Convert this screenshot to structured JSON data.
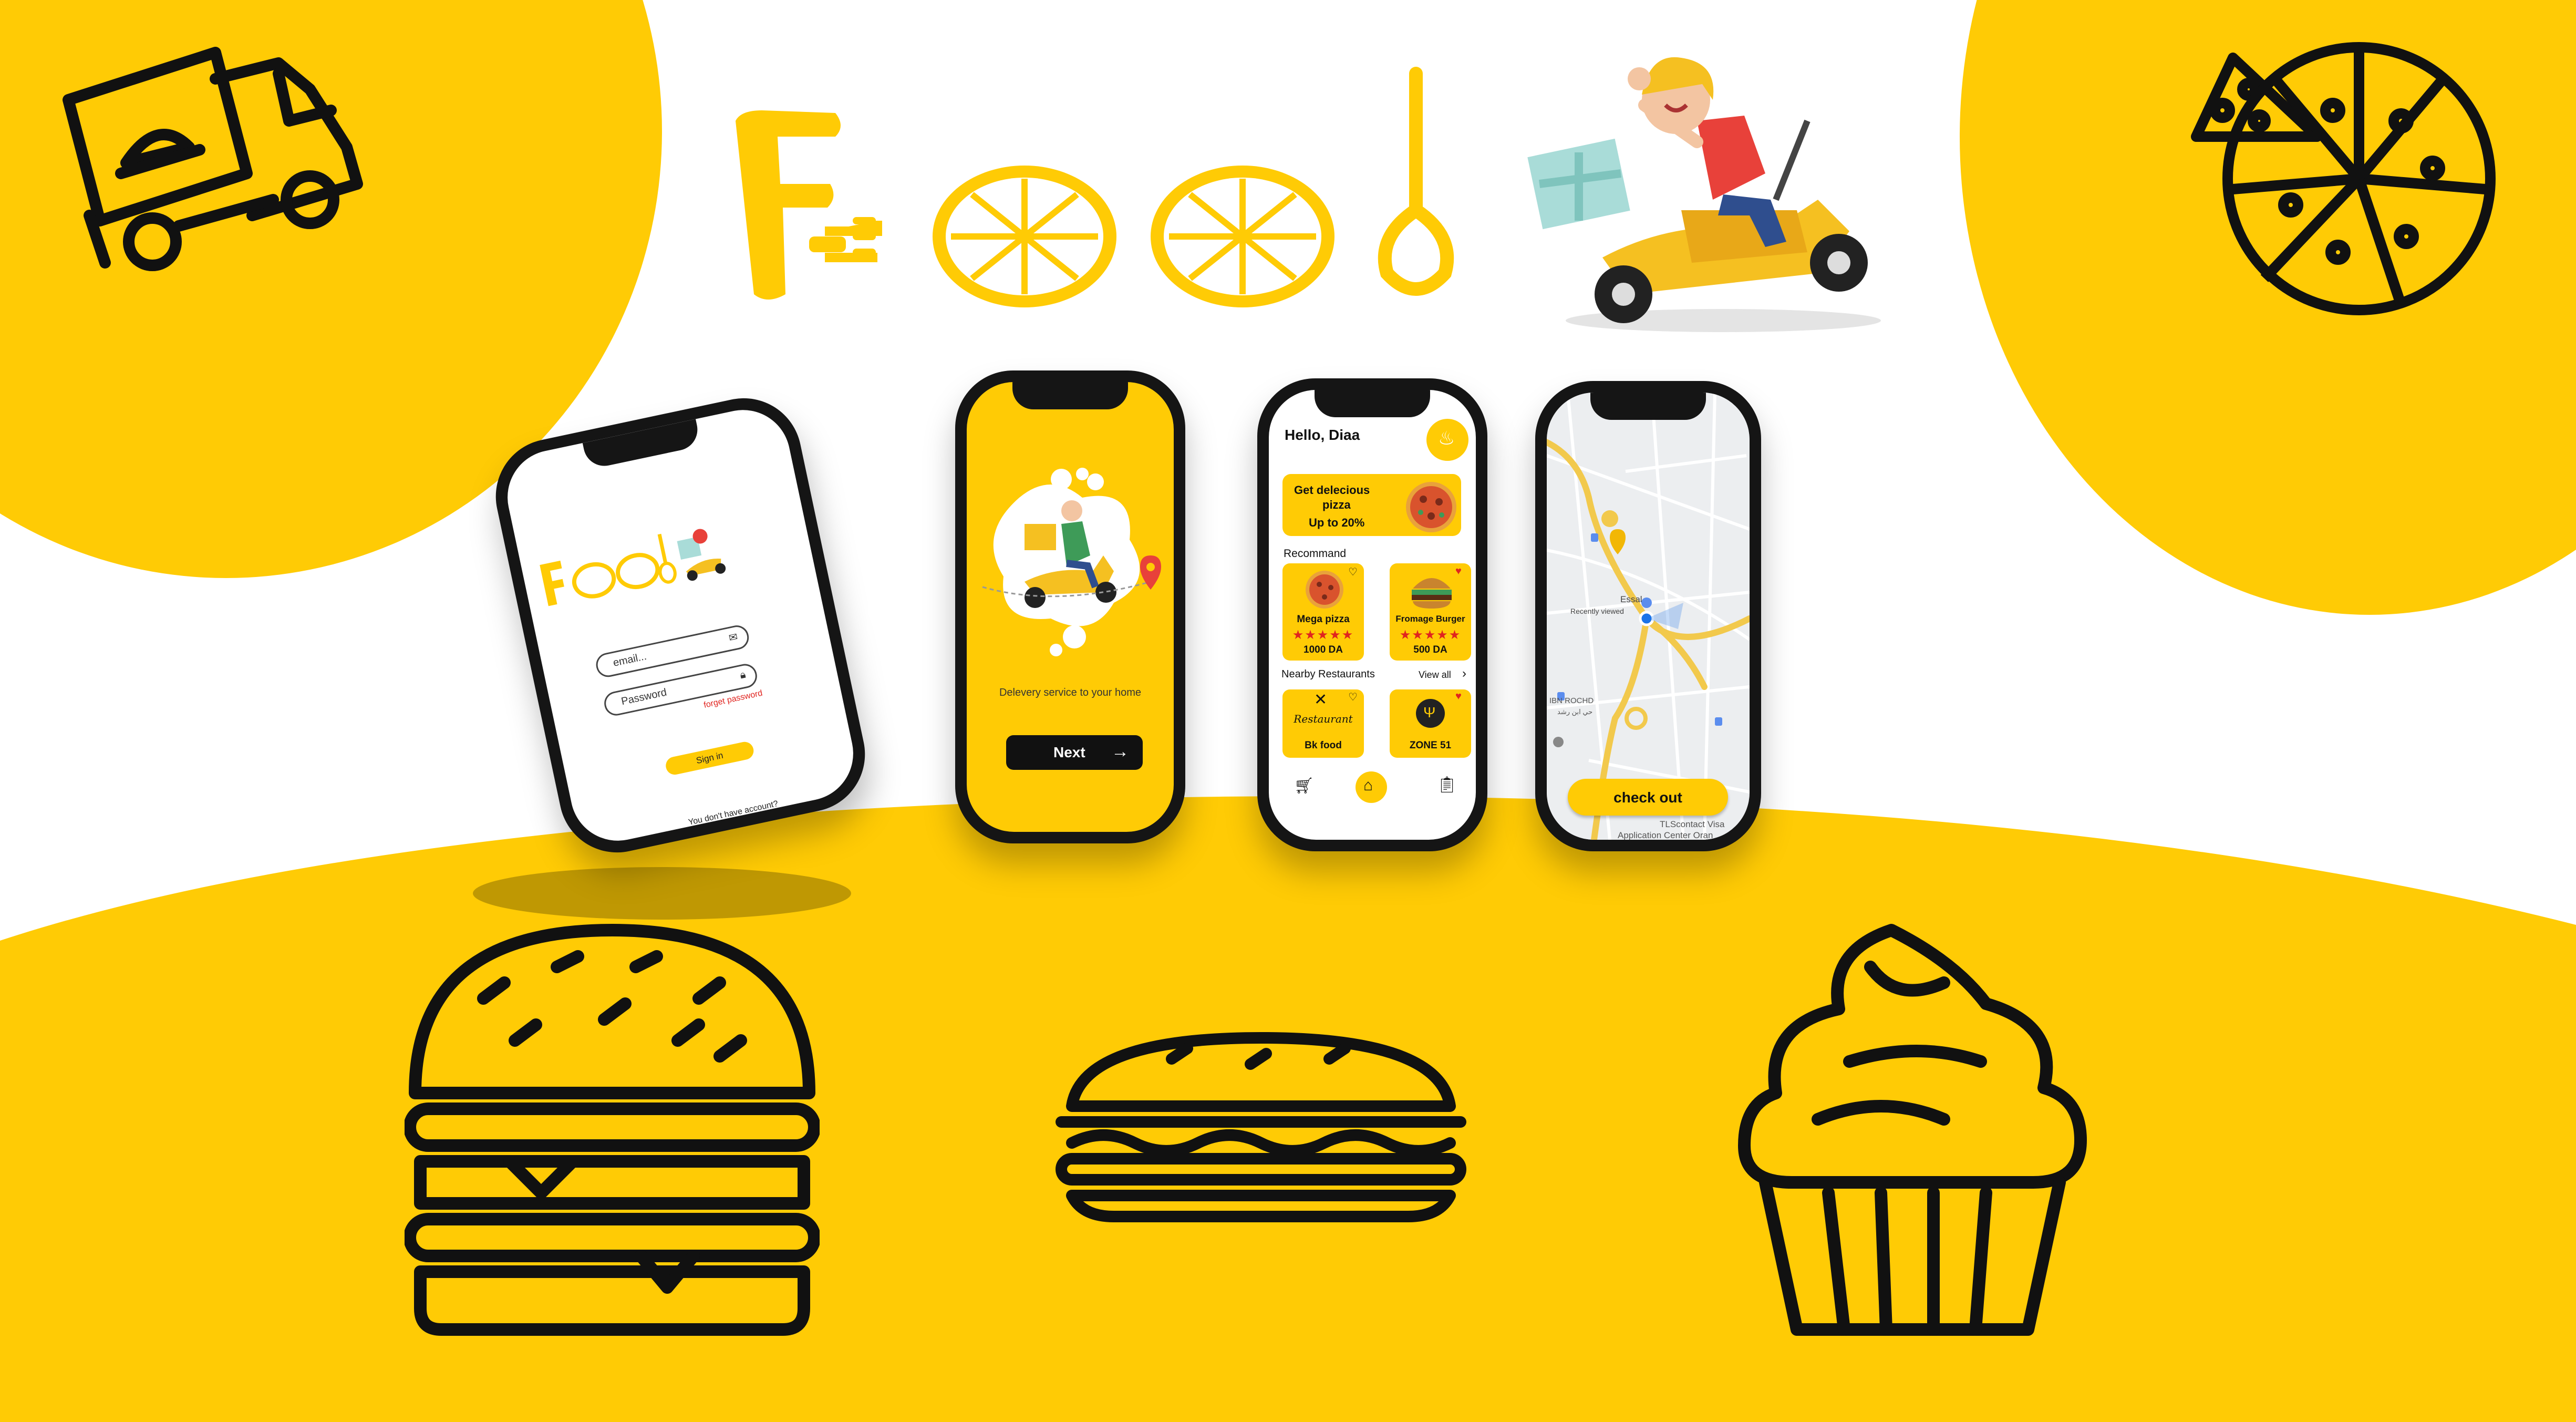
{
  "brand": {
    "logo_text": "Food",
    "yellow": "#ffcb05",
    "black": "#111111"
  },
  "login_screen": {
    "logo_text": "Food",
    "email_placeholder": "email...",
    "password_placeholder": "Password",
    "forgot_link": "forget password",
    "signin_button": "Sign in",
    "no_account_text": "You don't have account?"
  },
  "onboarding_screen": {
    "caption": "Delevery service to your home",
    "next_button": "Next",
    "next_icon": "arrow-right-icon"
  },
  "home_screen": {
    "greeting": "Hello, Diaa",
    "profile_icon": "chef-hat-icon",
    "promo": {
      "line1": "Get delecious",
      "line2": "pizza",
      "line3": "Up to 20%"
    },
    "recommend_title": "Recommand",
    "recommend_items": [
      {
        "name": "Mega pizza",
        "stars": "★★★★★",
        "price": "1000 DA"
      },
      {
        "name": "Fromage Burger",
        "stars": "★★★★★",
        "price": "500 DA"
      }
    ],
    "nearby_title": "Nearby Restaurants",
    "view_all": "View all",
    "restaurants": [
      {
        "logo_text": "Restaurant",
        "name": "Bk food"
      },
      {
        "logo_text": "",
        "name": "ZONE 51"
      }
    ],
    "nav_icons": [
      "cart-icon",
      "home-icon",
      "clipboard-icon"
    ]
  },
  "map_screen": {
    "place_label": "Essal",
    "recent_label": "Recently viewed",
    "district_label": "IBN ROCHD",
    "arabic_label": "حي ابن رشد",
    "checkout_button": "check out",
    "poi_line1": "TLScontact Visa",
    "poi_line2": "Application Center Oran"
  }
}
